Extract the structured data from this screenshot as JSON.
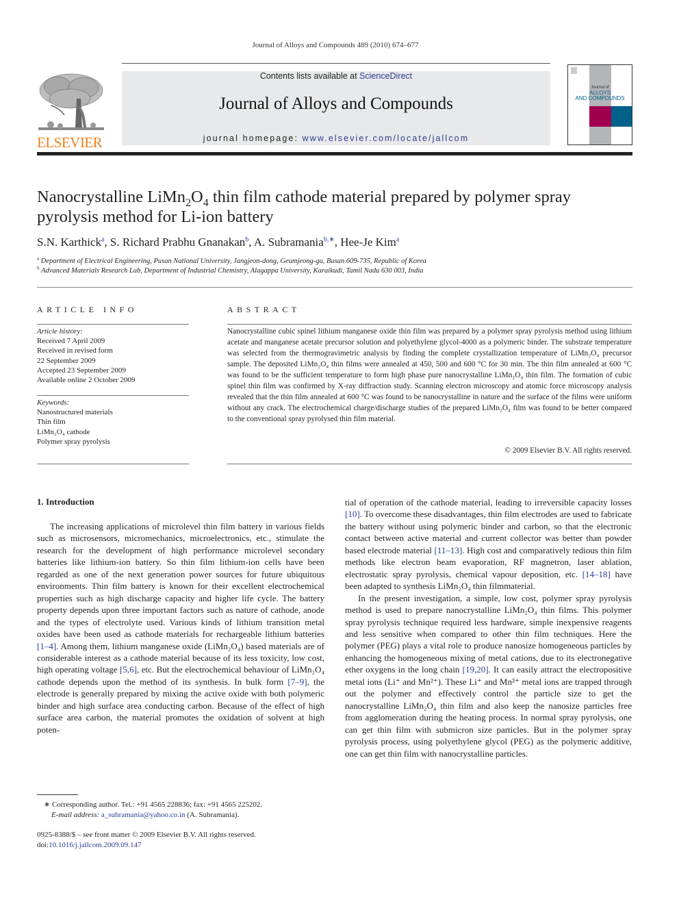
{
  "header": {
    "running_head": "Journal of Alloys and Compounds 489 (2010) 674–677",
    "contents_prefix": "Contents lists available at ",
    "contents_link": "ScienceDirect",
    "journal_title": "Journal of Alloys and Compounds",
    "homepage_prefix": "journal homepage: ",
    "homepage_link": "www.elsevier.com/locate/jallcom",
    "publisher_logo_text": "ELSEVIER",
    "cover": {
      "line1": "Journal of",
      "line2": "ALLOYS",
      "line3": "AND COMPOUNDS",
      "colors": {
        "gray": "#b3b5b8",
        "magenta": "#a10050",
        "teal": "#00618a"
      }
    }
  },
  "article": {
    "title_part1": "Nanocrystalline LiMn",
    "title_sub1": "2",
    "title_part2": "O",
    "title_sub2": "4",
    "title_part3": " thin film cathode material prepared by polymer spray",
    "title_line2": "pyrolysis method for Li-ion battery",
    "authors": [
      {
        "name": "S.N. Karthick",
        "sup": "a"
      },
      {
        "name": "S. Richard Prabhu Gnanakan",
        "sup": "b"
      },
      {
        "name": "A. Subramania",
        "sup": "b,∗"
      },
      {
        "name": "Hee-Je Kim",
        "sup": "a"
      }
    ],
    "affiliations": [
      {
        "sup": "a",
        "text": "Department of Electrical Engineering, Pusan National University, Jangjeon-dong, Geumjeong-gu, Busan 609-735, Republic of Korea"
      },
      {
        "sup": "b",
        "text": "Advanced Materials Research Lab, Department of Industrial Chemistry, Alagappa University, Karaikudi, Tamil Nadu 630 003, India"
      }
    ]
  },
  "article_info": {
    "heading": "ARTICLE INFO",
    "history_label": "Article history:",
    "history": [
      "Received 7 April 2009",
      "Received in revised form",
      "22 September 2009",
      "Accepted 23 September 2009",
      "Available online 2 October 2009"
    ],
    "keywords_label": "Keywords:",
    "keywords": [
      "Nanostructured materials",
      "Thin film",
      "LiMn₂O₄ cathode",
      "Polymer spray pyrolysis"
    ]
  },
  "abstract": {
    "heading": "ABSTRACT",
    "text": "Nanocrystalline cubic spinel lithium manganese oxide thin film was prepared by a polymer spray pyrolysis method using lithium acetate and manganese acetate precursor solution and polyethylene glycol-4000 as a polymeric binder. The substrate temperature was selected from the thermogravimetric analysis by finding the complete crystallization temperature of LiMn₂O₄ precursor sample. The deposited LiMn₂O₄ thin films were annealed at 450, 500 and 600 °C for 30 min. The thin film annealed at 600 °C was found to be the sufficient temperature to form high phase pure nanocrystalline LiMn₂O₄ thin film. The formation of cubic spinel thin film was confirmed by X-ray diffraction study. Scanning electron microscopy and atomic force microscopy analysis revealed that the thin film annealed at 600 °C was found to be nanocrystalline in nature and the surface of the films were uniform without any crack. The electrochemical charge/discharge studies of the prepared LiMn₂O₄ film was found to be better compared to the conventional spray pyrolysed thin film material.",
    "copyright": "© 2009 Elsevier B.V. All rights reserved."
  },
  "introduction": {
    "heading": "1.  Introduction",
    "col1": [
      {
        "t": "The increasing applications of microlevel thin film battery in various fields such as microsensors, micromechanics, microelectronics, etc., stimulate the research for the development of high performance microlevel secondary batteries like lithium-ion battery. So thin film lithium-ion cells have been regarded as one of the next generation power sources for future ubiquitous environments. Thin film battery is known for their excellent electrochemical properties such as high discharge capacity and higher life cycle. The battery property depends upon three important factors such as nature of cathode, anode and the types of electrolyte used. Various kinds of lithium transition metal oxides have been used as cathode materials for rechargeable lithium batteries "
      },
      {
        "ref": "[1–4]"
      },
      {
        "t": ". Among them, lithium manganese oxide (LiMn₂O₄) based materials are of considerable interest as a cathode material because of its less toxicity, low cost, high operating voltage "
      },
      {
        "ref": "[5,6]"
      },
      {
        "t": ", etc. But the electrochemical behaviour of LiMn₂O₄ cathode depends upon the method of its synthesis. In bulk form "
      },
      {
        "ref": "[7–9]"
      },
      {
        "t": ", the electrode is generally prepared by mixing the active oxide with both polymeric binder and high surface area conducting carbon. Because of the effect of high surface area carbon, the material promotes the oxidation of solvent at high poten-"
      }
    ],
    "col2_p1": [
      {
        "t": "tial of operation of the cathode material, leading to irreversible capacity losses "
      },
      {
        "ref": "[10]"
      },
      {
        "t": ". To overcome these disadvantages, thin film electrodes are used to fabricate the battery without using polymeric binder and carbon, so that the electronic contact between active material and current collector was better than powder based electrode material "
      },
      {
        "ref": "[11–13]"
      },
      {
        "t": ". High cost and comparatively tedious thin film methods like electron beam evaporation, RF magnetron, laser ablation, electrostatic spray pyrolysis, chemical vapour deposition, etc. "
      },
      {
        "ref": "[14–18]"
      },
      {
        "t": " have been adapted to synthesis LiMn₂O₄ thin filmmaterial."
      }
    ],
    "col2_p2": [
      {
        "t": "In the present investigation, a simple, low cost, polymer spray pyrolysis method is used to prepare nanocrystalline LiMn₂O₄ thin films. This polymer spray pyrolysis technique required less hardware, simple inexpensive reagents and less sensitive when compared to other thin film techniques. Here the polymer (PEG) plays a vital role to produce nanosize homogeneous particles by enhancing the homogeneous mixing of metal cations, due to its electronegative ether oxygens in the long chain "
      },
      {
        "ref": "[19,20]"
      },
      {
        "t": ". It can easily attract the electropositive metal ions (Li⁺ and Mn²⁺). These Li⁺ and Mn²⁺ metal ions are trapped through out the polymer and effectively control the particle size to get the nanocrystalline LiMn₂O₄ thin film and also keep the nanosize particles free from agglomeration during the heating process. In normal spray pyrolysis, one can get thin film with submicron size particles. But in the polymer spray pyrolysis process, using polyethylene glycol (PEG) as the polymeric additive, one can get thin film with nanocrystalline particles."
      }
    ]
  },
  "footnotes": {
    "corresponding": "∗  Corresponding author. Tel.: +91 4565 228836; fax: +91 4565 225202.",
    "email_label": "E-mail address: ",
    "email": "a_subramania@yahoo.co.in",
    "email_suffix": " (A. Subramania).",
    "front_matter": "0925-8388/$ – see front matter © 2009 Elsevier B.V. All rights reserved.",
    "doi_prefix": "doi:",
    "doi": "10.1016/j.jallcom.2009.09.147"
  },
  "colors": {
    "link": "#2a3d8f",
    "elsevier_orange": "#f07f1c",
    "banner_bg": "#e8e9ea"
  }
}
